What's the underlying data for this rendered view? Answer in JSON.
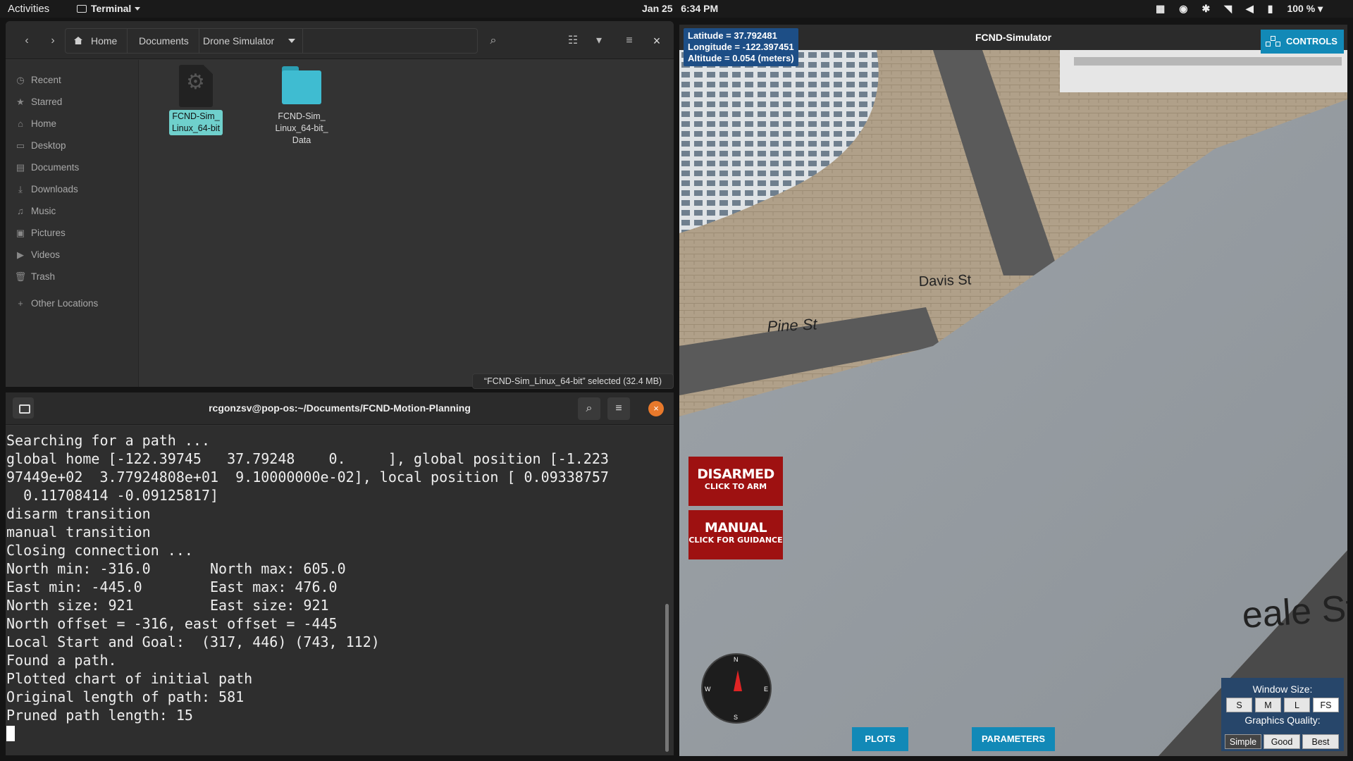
{
  "topbar": {
    "activities": "Activities",
    "app_name": "Terminal",
    "date": "Jan 25",
    "time": "6:34 PM",
    "battery": "100 %"
  },
  "files": {
    "breadcrumbs": [
      "Home",
      "Documents",
      "Drone Simulator"
    ],
    "sidebar": [
      {
        "label": "Recent",
        "icon": "clock-icon"
      },
      {
        "label": "Starred",
        "icon": "star-icon"
      },
      {
        "label": "Home",
        "icon": "home-icon"
      },
      {
        "label": "Desktop",
        "icon": "desktop-icon"
      },
      {
        "label": "Documents",
        "icon": "document-icon"
      },
      {
        "label": "Downloads",
        "icon": "download-icon"
      },
      {
        "label": "Music",
        "icon": "music-icon"
      },
      {
        "label": "Pictures",
        "icon": "picture-icon"
      },
      {
        "label": "Videos",
        "icon": "video-icon"
      },
      {
        "label": "Trash",
        "icon": "trash-icon"
      },
      {
        "label": "Other Locations",
        "icon": "plus-icon"
      }
    ],
    "items": [
      {
        "name_l1": "FCND-Sim_",
        "name_l2": "Linux_64-bit",
        "name_l3": ""
      },
      {
        "name_l1": "FCND-Sim_",
        "name_l2": "Linux_64-bit_",
        "name_l3": "Data"
      }
    ],
    "status": "“FCND-Sim_Linux_64-bit” selected  (32.4 MB)"
  },
  "terminal": {
    "title": "rcgonzsv@pop-os:~/Documents/FCND-Motion-Planning",
    "lines": [
      "Searching for a path ...",
      "global home [-122.39745   37.79248    0.     ], global position [-1.223",
      "97449e+02  3.77924808e+01  9.10000000e-02], local position [ 0.09338757",
      "  0.11708414 -0.09125817]",
      "disarm transition",
      "manual transition",
      "Closing connection ...",
      "North min: -316.0       North max: 605.0",
      "East min: -445.0        East max: 476.0",
      "North size: 921         East size: 921",
      "North offset = -316, east offset = -445",
      "Local Start and Goal:  (317, 446) (743, 112)",
      "Found a path.",
      "Plotted chart of initial path",
      "Original length of path: 581",
      "Pruned path length: 15"
    ]
  },
  "simulator": {
    "title": "FCND-Simulator",
    "latitude": "Latitude = 37.792481",
    "longitude": "Longitude = -122.397451",
    "altitude": "Altitude = 0.054 (meters)",
    "controls": "CONTROLS",
    "street_davis": "Davis St",
    "street_pine": "Pine St",
    "street_beale": "eale St",
    "arm_big": "DISARMED",
    "arm_small": "CLICK TO ARM",
    "mode_big": "MANUAL",
    "mode_small": "CLICK FOR GUIDANCE",
    "compass": {
      "n": "N",
      "s": "S",
      "e": "E",
      "w": "W"
    },
    "plots": "PLOTS",
    "parameters": "PARAMETERS",
    "window_size_label": "Window Size:",
    "window_sizes": [
      "S",
      "M",
      "L",
      "FS"
    ],
    "quality_label": "Graphics Quality:",
    "qualities": [
      "Simple",
      "Good",
      "Best"
    ]
  }
}
